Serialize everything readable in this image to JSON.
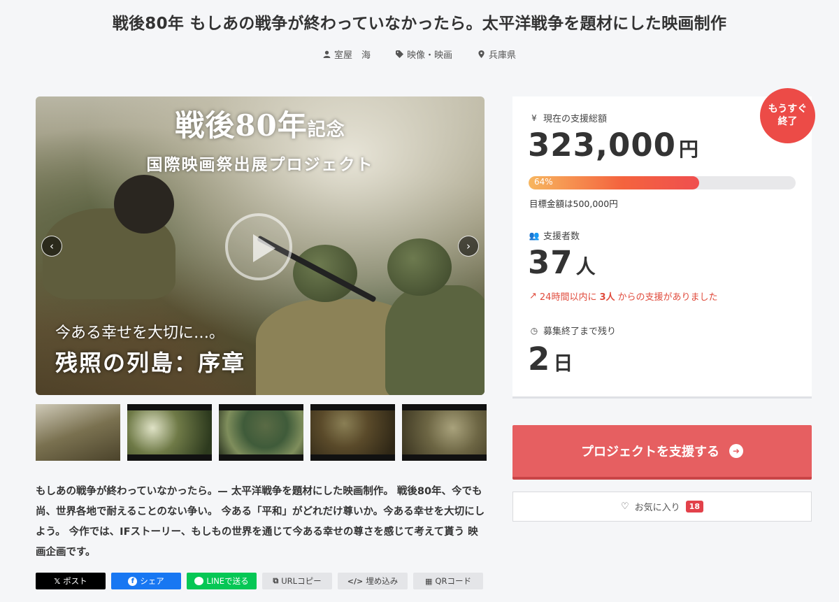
{
  "header": {
    "title": "戦後80年 もしあの戦争が終わっていなかったら。太平洋戦争を題材にした映画制作",
    "owner": "室屋　海",
    "category": "映像・映画",
    "location": "兵庫県"
  },
  "hero": {
    "line1_main": "戦後80年",
    "line1_small": "記念",
    "line2": "国際映画祭出展プロジェクト",
    "line3": "今ある幸せを大切に…。",
    "line4": "残照の列島：序章",
    "prev_arrow": "‹",
    "next_arrow": "›"
  },
  "description": "もしあの戦争が終わっていなかったら。— 太平洋戦争を題材にした映画制作。 戦後80年、今でも尚、世界各地で耐えることのない争い。 今ある「平和」がどれだけ尊いか。今ある幸せを大切にしよう。 今作では、IFストーリー、もしもの世界を通じて今ある幸せの尊さを感じて考えて貰う 映画企画です。",
  "share": {
    "post": "ポスト",
    "share": "シェア",
    "line": "LINEで送る",
    "url_copy": "URLコピー",
    "embed": "埋め込み",
    "qr": "QRコード"
  },
  "stats": {
    "total_label": "現在の支援総額",
    "total_value": "323,000",
    "total_unit": "円",
    "progress_text": "64%",
    "progress_pct": 64,
    "goal_text": "目標金額は500,000円",
    "supporters_label": "支援者数",
    "supporters_value": "37",
    "supporters_unit": "人",
    "recent_prefix": "24時間以内に",
    "recent_count": "3人",
    "recent_suffix": "からの支援がありました",
    "remaining_label": "募集終了まで残り",
    "remaining_value": "2",
    "remaining_unit": "日"
  },
  "badge": {
    "line1": "もうすぐ",
    "line2": "終了"
  },
  "actions": {
    "support_label": "プロジェクトを支援する",
    "favorite_label": "お気に入り",
    "favorite_count": "18"
  },
  "colors": {
    "accent": "#e65f61",
    "badge": "#ec4b47",
    "progress_start": "#f7b65f",
    "progress_end": "#ef4f4f",
    "recent_text": "#e04b3c"
  }
}
